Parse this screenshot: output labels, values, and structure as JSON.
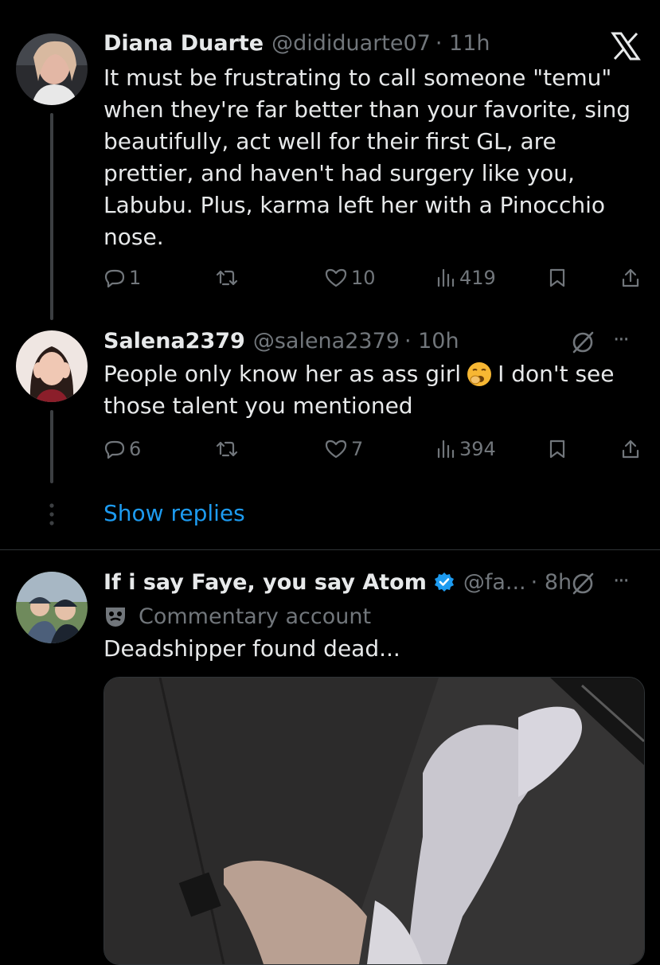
{
  "colors": {
    "bg": "#000000",
    "text": "#e7e9ea",
    "muted": "#71767b",
    "link": "#1d9bf0",
    "verified": "#1d9bf0",
    "emoji": "#f7b733"
  },
  "tweet1": {
    "name": "Diana Duarte",
    "handle": "@dididuarte07",
    "time": "· 11h",
    "lines": [
      "It must be frustrating to call someone \"temu\"",
      "when they're far better than your favorite, sing",
      "beautifully, act well for their first GL, are",
      "prettier, and haven't had surgery like you,",
      "Labubu. Plus, karma left her with a Pinocchio",
      "nose."
    ],
    "replies": "1",
    "likes": "10",
    "views": "419",
    "x_logo": "X"
  },
  "tweet2": {
    "name": "Salena2379",
    "handle": "@salena2379",
    "time": "· 10h",
    "line1_a": "People only know her as ass girl",
    "line1_b": "I don't see",
    "line2": "those talent you mentioned",
    "replies": "6",
    "likes": "7",
    "views": "394",
    "more": "···"
  },
  "show_replies": "Show replies",
  "tweet3": {
    "name": "If i say Faye, you say Atom",
    "handle": "@fa...",
    "time": "· 8h",
    "label_icon": "mask-icon",
    "label": "Commentary account",
    "text": "Deadshipper found dead...",
    "more": "···"
  }
}
